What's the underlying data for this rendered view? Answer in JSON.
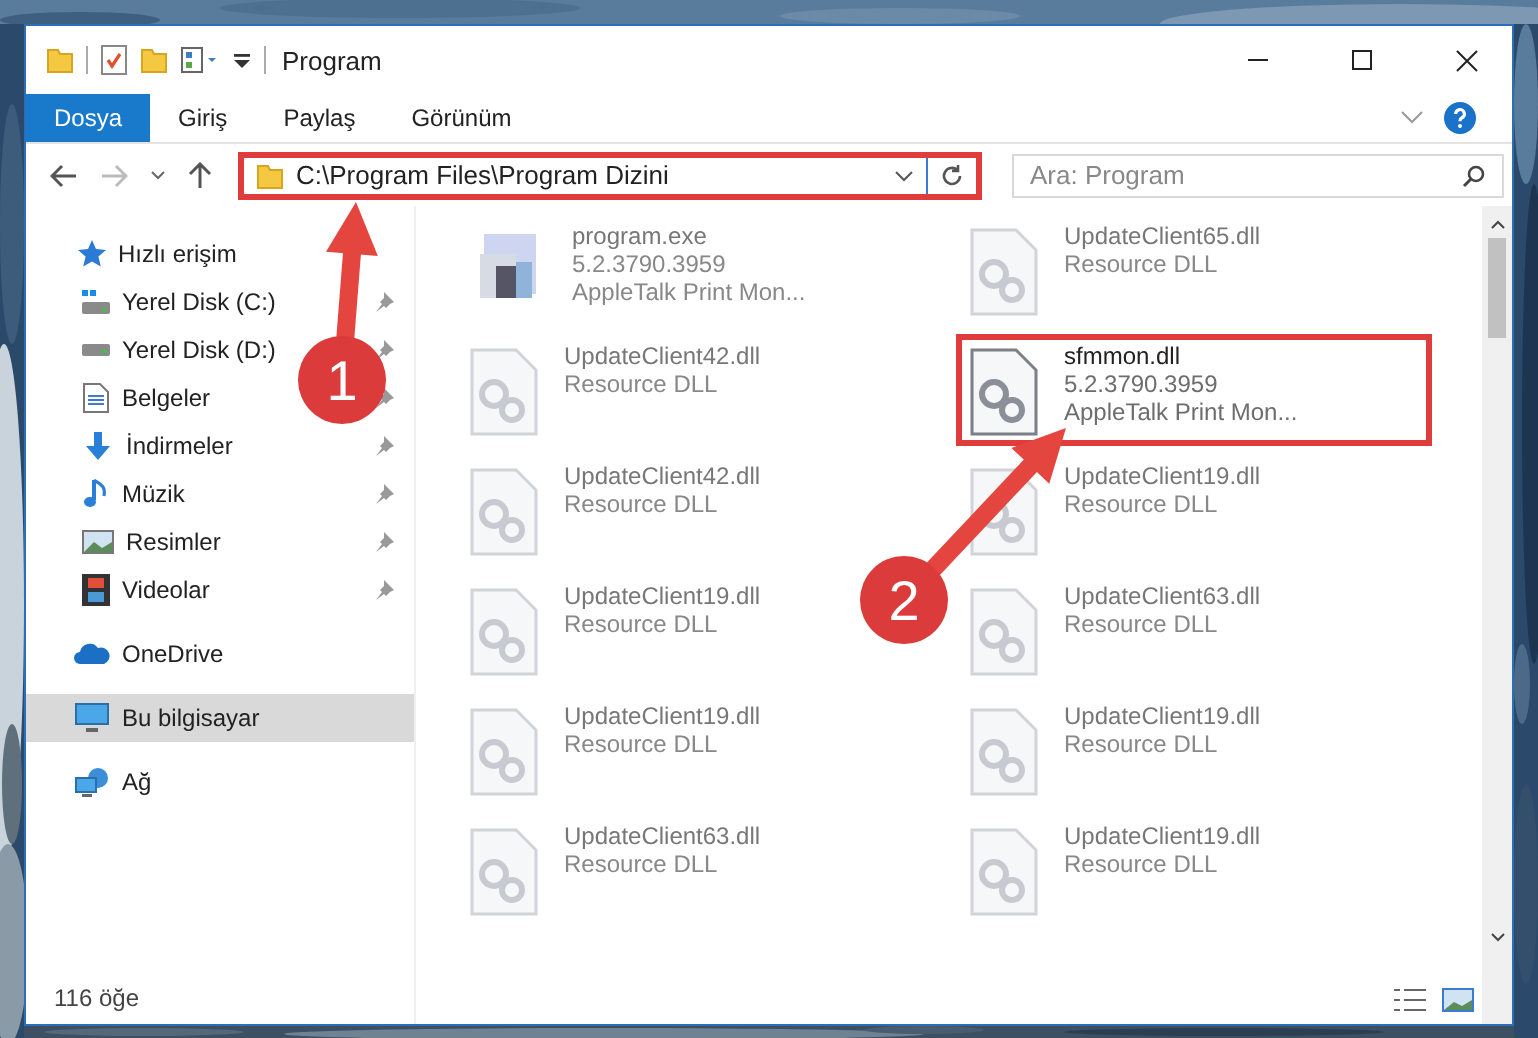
{
  "window": {
    "title": "Program"
  },
  "ribbon": {
    "tabs": [
      {
        "label": "Dosya",
        "selected": true
      },
      {
        "label": "Giriş",
        "selected": false
      },
      {
        "label": "Paylaş",
        "selected": false
      },
      {
        "label": "Görünüm",
        "selected": false
      }
    ]
  },
  "address_bar": {
    "path": "C:\\Program Files\\Program Dizini",
    "highlighted": true
  },
  "search": {
    "placeholder": "Ara: Program"
  },
  "sidebar": {
    "items": [
      {
        "label": "Hızlı erişim",
        "pinned": false,
        "selected": false
      },
      {
        "label": "Yerel Disk (C:)",
        "pinned": true,
        "selected": false
      },
      {
        "label": "Yerel Disk (D:)",
        "pinned": true,
        "selected": false
      },
      {
        "label": "Belgeler",
        "pinned": true,
        "selected": false
      },
      {
        "label": "İndirmeler",
        "pinned": true,
        "selected": false
      },
      {
        "label": "Müzik",
        "pinned": true,
        "selected": false
      },
      {
        "label": "Resimler",
        "pinned": true,
        "selected": false
      },
      {
        "label": "Videolar",
        "pinned": true,
        "selected": false
      },
      {
        "label": "OneDrive",
        "pinned": false,
        "selected": false
      },
      {
        "label": "Bu bilgisayar",
        "pinned": false,
        "selected": true
      },
      {
        "label": "Ağ",
        "pinned": false,
        "selected": false
      }
    ]
  },
  "files": [
    {
      "kind": "exe",
      "name": "program.exe",
      "lines": [
        "5.2.3790.3959",
        "AppleTalk Print Mon..."
      ],
      "highlighted": false
    },
    {
      "kind": "dll",
      "name": "UpdateClient65.dll",
      "lines": [
        "Resource DLL"
      ],
      "highlighted": false
    },
    {
      "kind": "dll",
      "name": "UpdateClient42.dll",
      "lines": [
        "Resource DLL"
      ],
      "highlighted": false
    },
    {
      "kind": "dll",
      "name": "sfmmon.dll",
      "lines": [
        "5.2.3790.3959",
        "AppleTalk Print Mon..."
      ],
      "highlighted": true
    },
    {
      "kind": "dll",
      "name": "UpdateClient42.dll",
      "lines": [
        "Resource DLL"
      ],
      "highlighted": false
    },
    {
      "kind": "dll",
      "name": "UpdateClient19.dll",
      "lines": [
        "Resource DLL"
      ],
      "highlighted": false
    },
    {
      "kind": "dll",
      "name": "UpdateClient19.dll",
      "lines": [
        "Resource DLL"
      ],
      "highlighted": false
    },
    {
      "kind": "dll",
      "name": "UpdateClient63.dll",
      "lines": [
        "Resource DLL"
      ],
      "highlighted": false
    },
    {
      "kind": "dll",
      "name": "UpdateClient19.dll",
      "lines": [
        "Resource DLL"
      ],
      "highlighted": false
    },
    {
      "kind": "dll",
      "name": "UpdateClient19.dll",
      "lines": [
        "Resource DLL"
      ],
      "highlighted": false
    },
    {
      "kind": "dll",
      "name": "UpdateClient63.dll",
      "lines": [
        "Resource DLL"
      ],
      "highlighted": false
    },
    {
      "kind": "dll",
      "name": "UpdateClient19.dll",
      "lines": [
        "Resource DLL"
      ],
      "highlighted": false
    }
  ],
  "status_bar": {
    "item_count": "116 öğe"
  },
  "annotations": [
    {
      "number": "1"
    },
    {
      "number": "2"
    }
  ]
}
